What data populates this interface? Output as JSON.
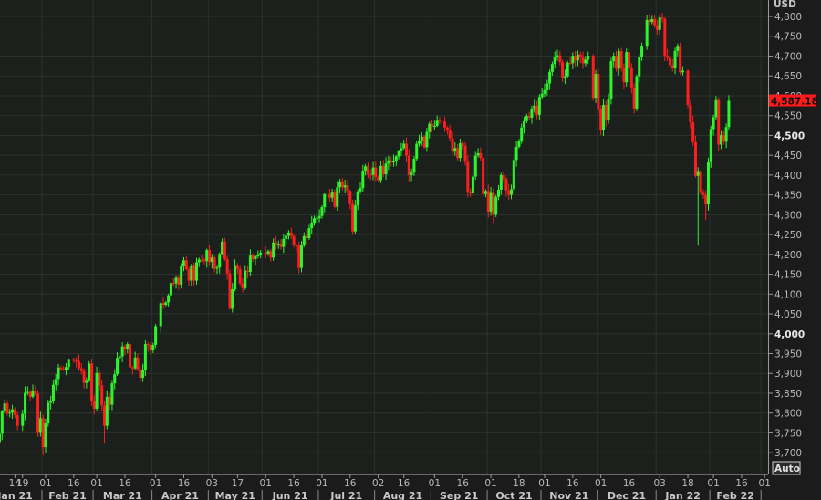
{
  "chart_data": {
    "type": "candlestick",
    "currency_label": "USD",
    "last_price_label": "4,587.18",
    "auto_button": "Auto",
    "ylim": [
      3650,
      4830
    ],
    "y_ticks": [
      {
        "value": 4800,
        "label": "4,800"
      },
      {
        "value": 4750,
        "label": "4,750"
      },
      {
        "value": 4700,
        "label": "4,700"
      },
      {
        "value": 4650,
        "label": "4,650"
      },
      {
        "value": 4600,
        "label": "4,600"
      },
      {
        "value": 4550,
        "label": "4,550"
      },
      {
        "value": 4500,
        "label": "4,500",
        "bold": true
      },
      {
        "value": 4450,
        "label": "4,450"
      },
      {
        "value": 4400,
        "label": "4,400"
      },
      {
        "value": 4350,
        "label": "4,350"
      },
      {
        "value": 4300,
        "label": "4,300"
      },
      {
        "value": 4250,
        "label": "4,250"
      },
      {
        "value": 4200,
        "label": "4,200"
      },
      {
        "value": 4150,
        "label": "4,150"
      },
      {
        "value": 4100,
        "label": "4,100"
      },
      {
        "value": 4050,
        "label": "4,050"
      },
      {
        "value": 4000,
        "label": "4,000",
        "bold": true
      },
      {
        "value": 3950,
        "label": "3,950"
      },
      {
        "value": 3900,
        "label": "3,900"
      },
      {
        "value": 3850,
        "label": "3,850"
      },
      {
        "value": 3800,
        "label": "3,800"
      },
      {
        "value": 3750,
        "label": "3,750"
      },
      {
        "value": 3700,
        "label": "3,700"
      }
    ],
    "x_ticks": [
      {
        "date": "2021-01-14",
        "label": "14"
      },
      {
        "date": "2021-01-19",
        "label": "19"
      },
      {
        "date": "2021-02-01",
        "label": "01"
      },
      {
        "date": "2021-02-16",
        "label": "16"
      },
      {
        "date": "2021-03-01",
        "label": "01"
      },
      {
        "date": "2021-03-16",
        "label": "16"
      },
      {
        "date": "2021-04-01",
        "label": "01"
      },
      {
        "date": "2021-04-16",
        "label": "16"
      },
      {
        "date": "2021-05-03",
        "label": "03"
      },
      {
        "date": "2021-05-17",
        "label": "17"
      },
      {
        "date": "2021-06-01",
        "label": "01"
      },
      {
        "date": "2021-06-16",
        "label": "16"
      },
      {
        "date": "2021-07-01",
        "label": "01"
      },
      {
        "date": "2021-07-16",
        "label": "16"
      },
      {
        "date": "2021-08-02",
        "label": "02"
      },
      {
        "date": "2021-08-16",
        "label": "16"
      },
      {
        "date": "2021-09-01",
        "label": "01"
      },
      {
        "date": "2021-09-16",
        "label": "16"
      },
      {
        "date": "2021-10-01",
        "label": "01"
      },
      {
        "date": "2021-10-18",
        "label": "18"
      },
      {
        "date": "2021-11-01",
        "label": "01"
      },
      {
        "date": "2021-11-16",
        "label": "16"
      },
      {
        "date": "2021-12-01",
        "label": "01"
      },
      {
        "date": "2021-12-16",
        "label": "16"
      },
      {
        "date": "2022-01-03",
        "label": "03"
      },
      {
        "date": "2022-01-18",
        "label": "18"
      },
      {
        "date": "2022-02-01",
        "label": "01"
      },
      {
        "date": "2022-02-16",
        "label": "16"
      },
      {
        "date": "2022-03-01",
        "label": "01"
      }
    ],
    "months": [
      {
        "start": "2021-01-01",
        "label": "Jan 21"
      },
      {
        "start": "2021-02-01",
        "label": "Feb 21"
      },
      {
        "start": "2021-03-01",
        "label": "Mar 21"
      },
      {
        "start": "2021-04-01",
        "label": "Apr 21"
      },
      {
        "start": "2021-05-03",
        "label": "May 21"
      },
      {
        "start": "2021-06-01",
        "label": "Jun 21"
      },
      {
        "start": "2021-07-01",
        "label": "Jul 21"
      },
      {
        "start": "2021-08-02",
        "label": "Aug 21"
      },
      {
        "start": "2021-09-01",
        "label": "Sep 21"
      },
      {
        "start": "2021-10-01",
        "label": "Oct 21"
      },
      {
        "start": "2021-11-01",
        "label": "Nov 21"
      },
      {
        "start": "2021-12-01",
        "label": "Dec 21"
      },
      {
        "start": "2022-01-03",
        "label": "Jan 22"
      },
      {
        "start": "2022-02-01",
        "label": "Feb 22"
      },
      {
        "start": "2022-03-01",
        "label": ""
      }
    ],
    "colors": {
      "up": "#2cf52c",
      "down": "#ff1e1e",
      "background": "#1c201c",
      "grid": "#2c322c",
      "axis": "#9a9a9a",
      "last_price_bg": "#ff1a1a"
    },
    "closes": [
      [
        "2021-01-05",
        3727
      ],
      [
        "2021-01-06",
        3748
      ],
      [
        "2021-01-07",
        3804
      ],
      [
        "2021-01-08",
        3824
      ],
      [
        "2021-01-11",
        3799
      ],
      [
        "2021-01-12",
        3801
      ],
      [
        "2021-01-13",
        3809
      ],
      [
        "2021-01-14",
        3795
      ],
      [
        "2021-01-15",
        3768
      ],
      [
        "2021-01-19",
        3798
      ],
      [
        "2021-01-20",
        3851
      ],
      [
        "2021-01-21",
        3853
      ],
      [
        "2021-01-22",
        3841
      ],
      [
        "2021-01-25",
        3855
      ],
      [
        "2021-01-26",
        3849
      ],
      [
        "2021-01-27",
        3750
      ],
      [
        "2021-01-28",
        3787
      ],
      [
        "2021-01-29",
        3714
      ],
      [
        "2021-02-01",
        3774
      ],
      [
        "2021-02-02",
        3826
      ],
      [
        "2021-02-03",
        3830
      ],
      [
        "2021-02-04",
        3871
      ],
      [
        "2021-02-05",
        3886
      ],
      [
        "2021-02-08",
        3915
      ],
      [
        "2021-02-09",
        3911
      ],
      [
        "2021-02-10",
        3909
      ],
      [
        "2021-02-11",
        3916
      ],
      [
        "2021-02-12",
        3934
      ],
      [
        "2021-02-16",
        3932
      ],
      [
        "2021-02-17",
        3931
      ],
      [
        "2021-02-18",
        3913
      ],
      [
        "2021-02-19",
        3906
      ],
      [
        "2021-02-22",
        3876
      ],
      [
        "2021-02-23",
        3881
      ],
      [
        "2021-02-24",
        3925
      ],
      [
        "2021-02-25",
        3829
      ],
      [
        "2021-02-26",
        3811
      ],
      [
        "2021-03-01",
        3901
      ],
      [
        "2021-03-02",
        3870
      ],
      [
        "2021-03-03",
        3819
      ],
      [
        "2021-03-04",
        3768
      ],
      [
        "2021-03-05",
        3841
      ],
      [
        "2021-03-08",
        3821
      ],
      [
        "2021-03-09",
        3875
      ],
      [
        "2021-03-10",
        3898
      ],
      [
        "2021-03-11",
        3939
      ],
      [
        "2021-03-12",
        3943
      ],
      [
        "2021-03-15",
        3968
      ],
      [
        "2021-03-16",
        3962
      ],
      [
        "2021-03-17",
        3974
      ],
      [
        "2021-03-18",
        3915
      ],
      [
        "2021-03-19",
        3913
      ],
      [
        "2021-03-22",
        3940
      ],
      [
        "2021-03-23",
        3910
      ],
      [
        "2021-03-24",
        3889
      ],
      [
        "2021-03-25",
        3909
      ],
      [
        "2021-03-26",
        3974
      ],
      [
        "2021-03-29",
        3971
      ],
      [
        "2021-03-30",
        3958
      ],
      [
        "2021-03-31",
        3972
      ],
      [
        "2021-04-01",
        4019
      ],
      [
        "2021-04-05",
        4077
      ],
      [
        "2021-04-06",
        4073
      ],
      [
        "2021-04-07",
        4079
      ],
      [
        "2021-04-08",
        4097
      ],
      [
        "2021-04-09",
        4128
      ],
      [
        "2021-04-12",
        4127
      ],
      [
        "2021-04-13",
        4141
      ],
      [
        "2021-04-14",
        4124
      ],
      [
        "2021-04-15",
        4170
      ],
      [
        "2021-04-16",
        4185
      ],
      [
        "2021-04-19",
        4163
      ],
      [
        "2021-04-20",
        4134
      ],
      [
        "2021-04-21",
        4173
      ],
      [
        "2021-04-22",
        4134
      ],
      [
        "2021-04-23",
        4180
      ],
      [
        "2021-04-26",
        4187
      ],
      [
        "2021-04-27",
        4186
      ],
      [
        "2021-04-28",
        4183
      ],
      [
        "2021-04-29",
        4211
      ],
      [
        "2021-04-30",
        4181
      ],
      [
        "2021-05-03",
        4192
      ],
      [
        "2021-05-04",
        4164
      ],
      [
        "2021-05-05",
        4167
      ],
      [
        "2021-05-06",
        4201
      ],
      [
        "2021-05-07",
        4232
      ],
      [
        "2021-05-10",
        4188
      ],
      [
        "2021-05-11",
        4152
      ],
      [
        "2021-05-12",
        4063
      ],
      [
        "2021-05-13",
        4112
      ],
      [
        "2021-05-14",
        4173
      ],
      [
        "2021-05-17",
        4163
      ],
      [
        "2021-05-18",
        4127
      ],
      [
        "2021-05-19",
        4115
      ],
      [
        "2021-05-20",
        4159
      ],
      [
        "2021-05-21",
        4156
      ],
      [
        "2021-05-24",
        4197
      ],
      [
        "2021-05-25",
        4188
      ],
      [
        "2021-05-26",
        4195
      ],
      [
        "2021-05-27",
        4200
      ],
      [
        "2021-05-28",
        4204
      ],
      [
        "2021-06-01",
        4202
      ],
      [
        "2021-06-02",
        4208
      ],
      [
        "2021-06-03",
        4192
      ],
      [
        "2021-06-04",
        4230
      ],
      [
        "2021-06-07",
        4226
      ],
      [
        "2021-06-08",
        4227
      ],
      [
        "2021-06-09",
        4219
      ],
      [
        "2021-06-10",
        4239
      ],
      [
        "2021-06-11",
        4247
      ],
      [
        "2021-06-14",
        4255
      ],
      [
        "2021-06-15",
        4246
      ],
      [
        "2021-06-16",
        4223
      ],
      [
        "2021-06-17",
        4222
      ],
      [
        "2021-06-18",
        4166
      ],
      [
        "2021-06-21",
        4224
      ],
      [
        "2021-06-22",
        4246
      ],
      [
        "2021-06-23",
        4241
      ],
      [
        "2021-06-24",
        4266
      ],
      [
        "2021-06-25",
        4280
      ],
      [
        "2021-06-28",
        4291
      ],
      [
        "2021-06-29",
        4291
      ],
      [
        "2021-06-30",
        4297
      ],
      [
        "2021-07-01",
        4319
      ],
      [
        "2021-07-02",
        4352
      ],
      [
        "2021-07-06",
        4343
      ],
      [
        "2021-07-07",
        4358
      ],
      [
        "2021-07-08",
        4320
      ],
      [
        "2021-07-09",
        4369
      ],
      [
        "2021-07-12",
        4384
      ],
      [
        "2021-07-13",
        4369
      ],
      [
        "2021-07-14",
        4374
      ],
      [
        "2021-07-15",
        4360
      ],
      [
        "2021-07-16",
        4327
      ],
      [
        "2021-07-19",
        4258
      ],
      [
        "2021-07-20",
        4323
      ],
      [
        "2021-07-21",
        4359
      ],
      [
        "2021-07-22",
        4367
      ],
      [
        "2021-07-23",
        4411
      ],
      [
        "2021-07-26",
        4422
      ],
      [
        "2021-07-27",
        4401
      ],
      [
        "2021-07-28",
        4400
      ],
      [
        "2021-07-29",
        4419
      ],
      [
        "2021-07-30",
        4395
      ],
      [
        "2021-08-02",
        4387
      ],
      [
        "2021-08-03",
        4423
      ],
      [
        "2021-08-04",
        4402
      ],
      [
        "2021-08-05",
        4429
      ],
      [
        "2021-08-06",
        4437
      ],
      [
        "2021-08-09",
        4432
      ],
      [
        "2021-08-10",
        4436
      ],
      [
        "2021-08-11",
        4447
      ],
      [
        "2021-08-12",
        4460
      ],
      [
        "2021-08-13",
        4468
      ],
      [
        "2021-08-16",
        4479
      ],
      [
        "2021-08-17",
        4449
      ],
      [
        "2021-08-18",
        4400
      ],
      [
        "2021-08-19",
        4406
      ],
      [
        "2021-08-20",
        4441
      ],
      [
        "2021-08-23",
        4479
      ],
      [
        "2021-08-24",
        4486
      ],
      [
        "2021-08-25",
        4497
      ],
      [
        "2021-08-26",
        4470
      ],
      [
        "2021-08-27",
        4509
      ],
      [
        "2021-08-30",
        4529
      ],
      [
        "2021-08-31",
        4523
      ],
      [
        "2021-09-01",
        4524
      ],
      [
        "2021-09-02",
        4537
      ],
      [
        "2021-09-03",
        4535
      ],
      [
        "2021-09-07",
        4520
      ],
      [
        "2021-09-08",
        4514
      ],
      [
        "2021-09-09",
        4493
      ],
      [
        "2021-09-10",
        4459
      ],
      [
        "2021-09-13",
        4468
      ],
      [
        "2021-09-14",
        4443
      ],
      [
        "2021-09-15",
        4480
      ],
      [
        "2021-09-16",
        4474
      ],
      [
        "2021-09-17",
        4433
      ],
      [
        "2021-09-20",
        4358
      ],
      [
        "2021-09-21",
        4354
      ],
      [
        "2021-09-22",
        4396
      ],
      [
        "2021-09-23",
        4449
      ],
      [
        "2021-09-24",
        4455
      ],
      [
        "2021-09-27",
        4443
      ],
      [
        "2021-09-28",
        4352
      ],
      [
        "2021-09-29",
        4360
      ],
      [
        "2021-09-30",
        4308
      ],
      [
        "2021-10-01",
        4357
      ],
      [
        "2021-10-04",
        4300
      ],
      [
        "2021-10-05",
        4345
      ],
      [
        "2021-10-06",
        4363
      ],
      [
        "2021-10-07",
        4400
      ],
      [
        "2021-10-08",
        4391
      ],
      [
        "2021-10-11",
        4361
      ],
      [
        "2021-10-12",
        4350
      ],
      [
        "2021-10-13",
        4364
      ],
      [
        "2021-10-14",
        4438
      ],
      [
        "2021-10-15",
        4471
      ],
      [
        "2021-10-18",
        4486
      ],
      [
        "2021-10-19",
        4520
      ],
      [
        "2021-10-20",
        4536
      ],
      [
        "2021-10-21",
        4549
      ],
      [
        "2021-10-22",
        4545
      ],
      [
        "2021-10-25",
        4567
      ],
      [
        "2021-10-26",
        4575
      ],
      [
        "2021-10-27",
        4552
      ],
      [
        "2021-10-28",
        4597
      ],
      [
        "2021-10-29",
        4605
      ],
      [
        "2021-11-01",
        4614
      ],
      [
        "2021-11-02",
        4631
      ],
      [
        "2021-11-03",
        4660
      ],
      [
        "2021-11-04",
        4680
      ],
      [
        "2021-11-05",
        4697
      ],
      [
        "2021-11-08",
        4702
      ],
      [
        "2021-11-09",
        4685
      ],
      [
        "2021-11-10",
        4646
      ],
      [
        "2021-11-11",
        4649
      ],
      [
        "2021-11-12",
        4683
      ],
      [
        "2021-11-15",
        4682
      ],
      [
        "2021-11-16",
        4701
      ],
      [
        "2021-11-17",
        4689
      ],
      [
        "2021-11-18",
        4704
      ],
      [
        "2021-11-19",
        4698
      ],
      [
        "2021-11-22",
        4682
      ],
      [
        "2021-11-23",
        4691
      ],
      [
        "2021-11-24",
        4701
      ],
      [
        "2021-11-26",
        4595
      ],
      [
        "2021-11-29",
        4655
      ],
      [
        "2021-11-30",
        4567
      ],
      [
        "2021-12-01",
        4513
      ],
      [
        "2021-12-02",
        4577
      ],
      [
        "2021-12-03",
        4538
      ],
      [
        "2021-12-06",
        4592
      ],
      [
        "2021-12-07",
        4687
      ],
      [
        "2021-12-08",
        4701
      ],
      [
        "2021-12-09",
        4668
      ],
      [
        "2021-12-10",
        4712
      ],
      [
        "2021-12-13",
        4669
      ],
      [
        "2021-12-14",
        4634
      ],
      [
        "2021-12-15",
        4710
      ],
      [
        "2021-12-16",
        4669
      ],
      [
        "2021-12-17",
        4621
      ],
      [
        "2021-12-20",
        4568
      ],
      [
        "2021-12-21",
        4649
      ],
      [
        "2021-12-22",
        4697
      ],
      [
        "2021-12-23",
        4726
      ],
      [
        "2021-12-27",
        4791
      ],
      [
        "2021-12-28",
        4786
      ],
      [
        "2021-12-29",
        4793
      ],
      [
        "2021-12-30",
        4778
      ],
      [
        "2021-12-31",
        4766
      ],
      [
        "2022-01-03",
        4797
      ],
      [
        "2022-01-04",
        4794
      ],
      [
        "2022-01-05",
        4701
      ],
      [
        "2022-01-06",
        4696
      ],
      [
        "2022-01-07",
        4677
      ],
      [
        "2022-01-10",
        4670
      ],
      [
        "2022-01-11",
        4713
      ],
      [
        "2022-01-12",
        4726
      ],
      [
        "2022-01-13",
        4659
      ],
      [
        "2022-01-14",
        4663
      ],
      [
        "2022-01-18",
        4577
      ],
      [
        "2022-01-19",
        4533
      ],
      [
        "2022-01-20",
        4483
      ],
      [
        "2022-01-21",
        4398
      ],
      [
        "2022-01-24",
        4410
      ],
      [
        "2022-01-25",
        4357
      ],
      [
        "2022-01-26",
        4350
      ],
      [
        "2022-01-27",
        4326
      ],
      [
        "2022-01-28",
        4432
      ],
      [
        "2022-01-31",
        4516
      ],
      [
        "2022-02-01",
        4546
      ],
      [
        "2022-02-02",
        4589
      ],
      [
        "2022-02-03",
        4477
      ],
      [
        "2022-02-04",
        4501
      ],
      [
        "2022-02-07",
        4484
      ],
      [
        "2022-02-08",
        4521
      ],
      [
        "2022-02-09",
        4587.18
      ]
    ],
    "lows": {
      "2022-01-24": 4222,
      "2021-01-29": 3694,
      "2021-03-04": 3723,
      "2021-05-12": 4061,
      "2021-10-04": 4279,
      "2022-01-27": 4287
    }
  }
}
